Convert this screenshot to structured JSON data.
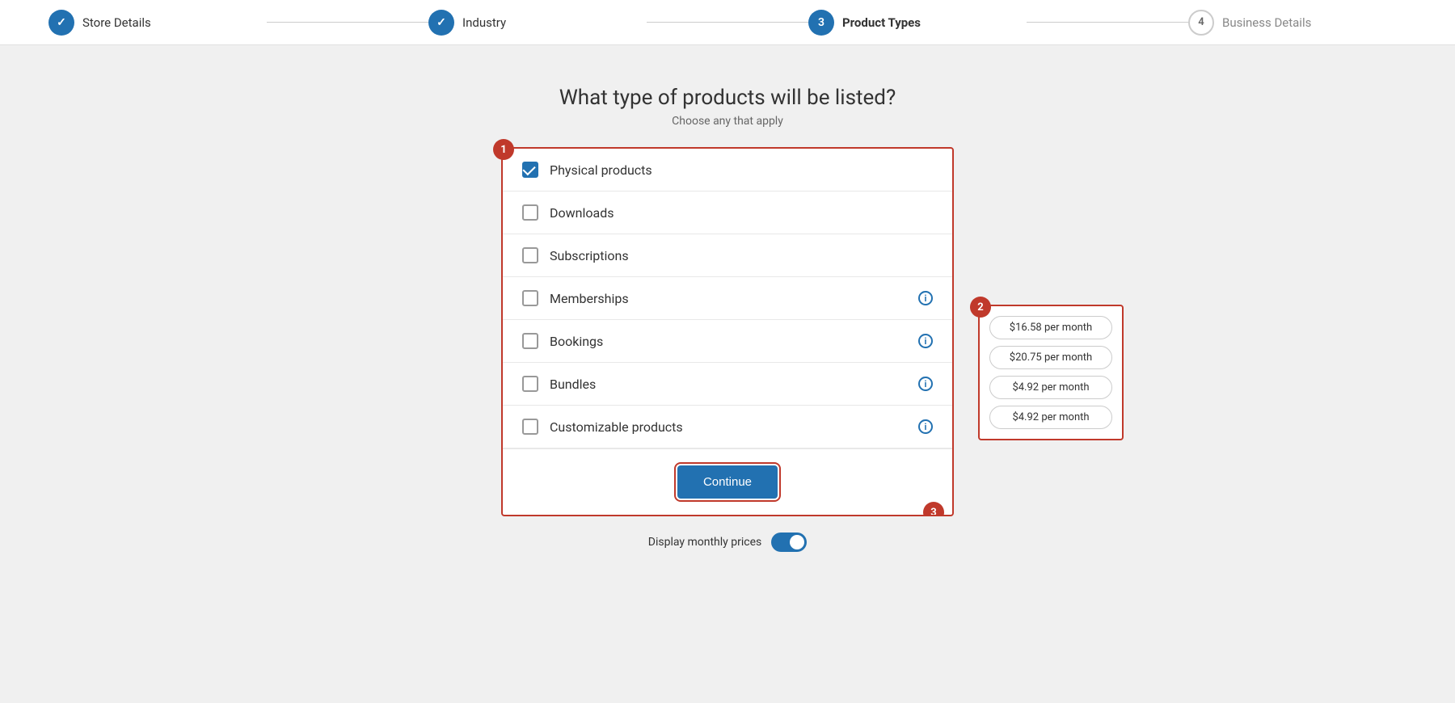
{
  "stepper": {
    "steps": [
      {
        "id": "store-details",
        "label": "Store Details",
        "state": "completed",
        "number": "✓"
      },
      {
        "id": "industry",
        "label": "Industry",
        "state": "completed",
        "number": "✓"
      },
      {
        "id": "product-types",
        "label": "Product Types",
        "state": "active",
        "number": "3"
      },
      {
        "id": "business-details",
        "label": "Business Details",
        "state": "inactive",
        "number": "4"
      }
    ]
  },
  "page": {
    "title": "What type of products will be listed?",
    "subtitle": "Choose any that apply"
  },
  "products": [
    {
      "id": "physical",
      "label": "Physical products",
      "checked": true,
      "hasInfo": false
    },
    {
      "id": "downloads",
      "label": "Downloads",
      "checked": false,
      "hasInfo": false
    },
    {
      "id": "subscriptions",
      "label": "Subscriptions",
      "checked": false,
      "hasInfo": false
    },
    {
      "id": "memberships",
      "label": "Memberships",
      "checked": false,
      "hasInfo": true
    },
    {
      "id": "bookings",
      "label": "Bookings",
      "checked": false,
      "hasInfo": true
    },
    {
      "id": "bundles",
      "label": "Bundles",
      "checked": false,
      "hasInfo": true
    },
    {
      "id": "customizable",
      "label": "Customizable products",
      "checked": false,
      "hasInfo": true
    }
  ],
  "pricing": [
    {
      "id": "memberships-price",
      "label": "$16.58 per month"
    },
    {
      "id": "bookings-price",
      "label": "$20.75 per month"
    },
    {
      "id": "bundles-price",
      "label": "$4.92 per month"
    },
    {
      "id": "customizable-price",
      "label": "$4.92 per month"
    }
  ],
  "buttons": {
    "continue": "Continue"
  },
  "toggle": {
    "label": "Display monthly prices",
    "enabled": true
  },
  "annotations": {
    "badge1": "1",
    "badge2": "2",
    "badge3": "3"
  }
}
